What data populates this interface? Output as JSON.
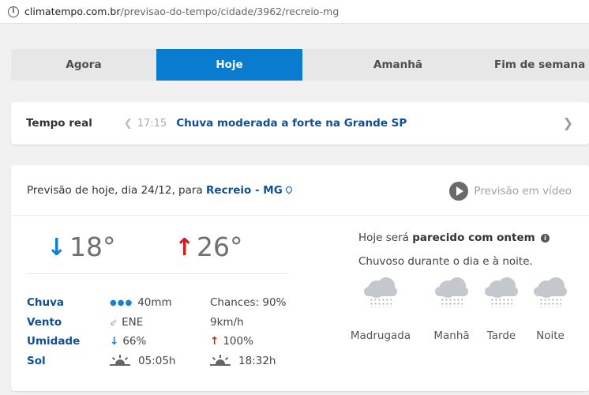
{
  "browser": {
    "url_host": "climatempo.com.br",
    "url_path": "/previsao-do-tempo/cidade/3962/recreio-mg"
  },
  "tabs": [
    {
      "label": "Agora",
      "active": false
    },
    {
      "label": "Hoje",
      "active": true
    },
    {
      "label": "Amanhã",
      "active": false
    },
    {
      "label": "Fim de semana",
      "active": false
    }
  ],
  "realtime": {
    "label": "Tempo real",
    "prev_icon": "chevron-left-icon",
    "time": "17:15",
    "headline": "Chuva moderada a forte na Grande SP",
    "next_icon": "chevron-right-icon"
  },
  "forecast": {
    "title_prefix": "Previsão de hoje, dia 24/12, para",
    "city": "Recreio - MG",
    "video_label": "Previsão em vídeo",
    "temp_min": "18°",
    "temp_max": "26°",
    "stats": {
      "rain_label": "Chuva",
      "rain_amount": "40mm",
      "rain_chance": "Chances: 90%",
      "wind_label": "Vento",
      "wind_dir": "ENE",
      "wind_speed": "9km/h",
      "humidity_label": "Umidade",
      "humidity_min": "66%",
      "humidity_max": "100%",
      "sun_label": "Sol",
      "sunrise": "05:05h",
      "sunset": "18:32h"
    },
    "similar_prefix": "Hoje será",
    "similar_bold": "parecido com ontem",
    "description": "Chuvoso durante o dia e à noite.",
    "periods": [
      {
        "label": "Madrugada",
        "icon": "rain-cloud-icon"
      },
      {
        "label": "Manhã",
        "icon": "rain-cloud-icon"
      },
      {
        "label": "Tarde",
        "icon": "rain-cloud-icon"
      },
      {
        "label": "Noite",
        "icon": "rain-cloud-icon"
      }
    ]
  },
  "colors": {
    "accent": "#0a7cd0",
    "link": "#0f4f94",
    "min_temp": "#0f7fcf",
    "max_temp": "#cf1f1f"
  }
}
